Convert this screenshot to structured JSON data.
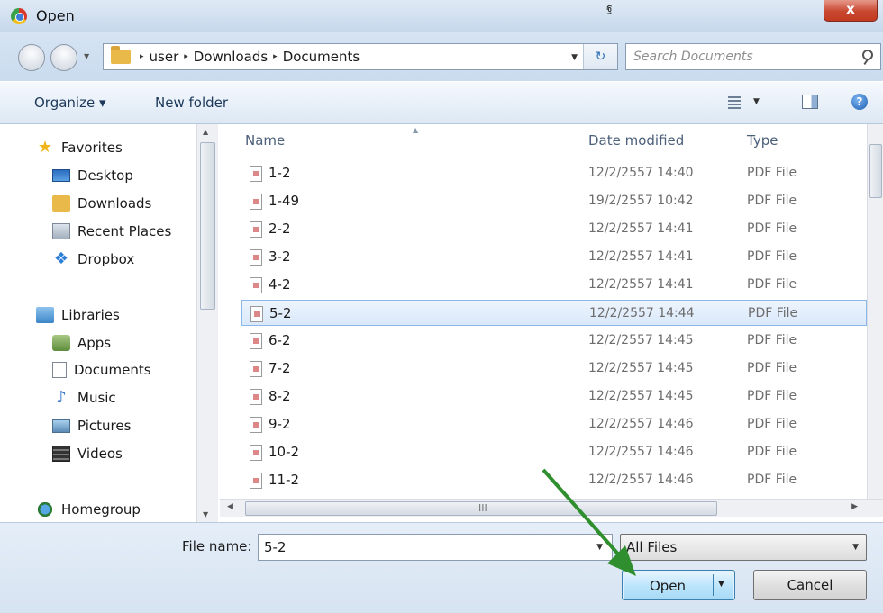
{
  "window": {
    "title": "Open",
    "close_label": "x",
    "top_glyph": "ฐ"
  },
  "address": {
    "crumbs": [
      "user",
      "Downloads",
      "Documents"
    ],
    "separator": "▸",
    "dropdown_glyph": "▼",
    "refresh_glyph": "↻"
  },
  "search": {
    "placeholder": "Search Documents"
  },
  "toolbar": {
    "organize_label": "Organize ▾",
    "new_folder_label": "New folder",
    "view_drop": "▼",
    "help_glyph": "?"
  },
  "sidebar": {
    "favorites": {
      "label": "Favorites",
      "icon": "star-icon"
    },
    "favorite_items": [
      {
        "label": "Desktop",
        "icon": "desktop-icon"
      },
      {
        "label": "Downloads",
        "icon": "downloads-icon"
      },
      {
        "label": "Recent Places",
        "icon": "recent-places-icon"
      },
      {
        "label": "Dropbox",
        "icon": "dropbox-icon"
      }
    ],
    "libraries": {
      "label": "Libraries",
      "icon": "libraries-icon"
    },
    "library_items": [
      {
        "label": "Apps",
        "icon": "apps-icon"
      },
      {
        "label": "Documents",
        "icon": "documents-icon"
      },
      {
        "label": "Music",
        "icon": "music-icon"
      },
      {
        "label": "Pictures",
        "icon": "pictures-icon"
      },
      {
        "label": "Videos",
        "icon": "videos-icon"
      }
    ],
    "homegroup": {
      "label": "Homegroup",
      "icon": "homegroup-icon"
    },
    "scroll_up": "▲",
    "scroll_down": "▼"
  },
  "file_list": {
    "columns": {
      "name": "Name",
      "date": "Date modified",
      "type": "Type"
    },
    "sort_glyph": "▲",
    "selected_name": "5-2",
    "rows": [
      {
        "name": "1-2",
        "date": "12/2/2557 14:40",
        "type": "PDF File"
      },
      {
        "name": "1-49",
        "date": "19/2/2557 10:42",
        "type": "PDF File"
      },
      {
        "name": "2-2",
        "date": "12/2/2557 14:41",
        "type": "PDF File"
      },
      {
        "name": "3-2",
        "date": "12/2/2557 14:41",
        "type": "PDF File"
      },
      {
        "name": "4-2",
        "date": "12/2/2557 14:41",
        "type": "PDF File"
      },
      {
        "name": "5-2",
        "date": "12/2/2557 14:44",
        "type": "PDF File"
      },
      {
        "name": "6-2",
        "date": "12/2/2557 14:45",
        "type": "PDF File"
      },
      {
        "name": "7-2",
        "date": "12/2/2557 14:45",
        "type": "PDF File"
      },
      {
        "name": "8-2",
        "date": "12/2/2557 14:45",
        "type": "PDF File"
      },
      {
        "name": "9-2",
        "date": "12/2/2557 14:46",
        "type": "PDF File"
      },
      {
        "name": "10-2",
        "date": "12/2/2557 14:46",
        "type": "PDF File"
      },
      {
        "name": "11-2",
        "date": "12/2/2557 14:46",
        "type": "PDF File"
      }
    ],
    "hscroll_grip": "III",
    "hscroll_left": "◀",
    "hscroll_right": "▶"
  },
  "footer": {
    "file_name_label": "File name:",
    "file_name_value": "5-2",
    "file_name_drop": "▼",
    "file_type_value": "All Files",
    "file_type_drop": "▼",
    "open_label": "Open",
    "open_drop": "▼",
    "cancel_label": "Cancel"
  },
  "colors": {
    "annotation_arrow": "#2f8f2f",
    "selection": "#d9e8fa",
    "window_chrome": "#c9d9ea"
  }
}
